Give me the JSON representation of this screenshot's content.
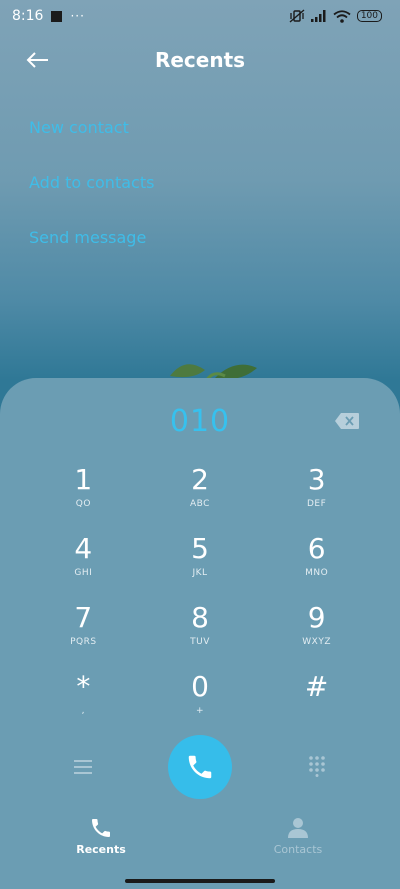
{
  "status_bar": {
    "time": "8:16",
    "overflow": "···",
    "battery": "100",
    "icons": [
      "notification-square-icon",
      "vibrate-off-icon",
      "signal-icon",
      "wifi-icon",
      "battery-icon"
    ]
  },
  "header": {
    "title": "Recents",
    "back_icon": "back-arrow-icon"
  },
  "actions": [
    {
      "label": "New contact"
    },
    {
      "label": "Add to contacts"
    },
    {
      "label": "Send message"
    }
  ],
  "dialer": {
    "number": "010",
    "keys": [
      {
        "digit": "1",
        "letters": "QO"
      },
      {
        "digit": "2",
        "letters": "ABC"
      },
      {
        "digit": "3",
        "letters": "DEF"
      },
      {
        "digit": "4",
        "letters": "GHI"
      },
      {
        "digit": "5",
        "letters": "JKL"
      },
      {
        "digit": "6",
        "letters": "MNO"
      },
      {
        "digit": "7",
        "letters": "PQRS"
      },
      {
        "digit": "8",
        "letters": "TUV"
      },
      {
        "digit": "9",
        "letters": "WXYZ"
      },
      {
        "digit": "*",
        "letters": ","
      },
      {
        "digit": "0",
        "letters": "+"
      },
      {
        "digit": "#",
        "letters": ""
      }
    ]
  },
  "bottom_nav": {
    "recents": "Recents",
    "contacts": "Contacts"
  },
  "colors": {
    "accent": "#36bdea",
    "sheet": "#6b9db3",
    "link": "#3fbde8"
  }
}
